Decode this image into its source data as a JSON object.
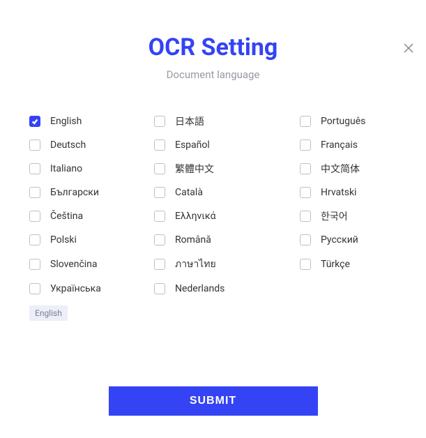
{
  "title": "OCR Setting",
  "subtitle": "Document language",
  "languages": [
    {
      "label": "English",
      "checked": true
    },
    {
      "label": "日本語",
      "checked": false
    },
    {
      "label": "Português",
      "checked": false
    },
    {
      "label": "Deutsch",
      "checked": false
    },
    {
      "label": "Español",
      "checked": false
    },
    {
      "label": "Français",
      "checked": false
    },
    {
      "label": "Italiano",
      "checked": false
    },
    {
      "label": "繁體中文",
      "checked": false
    },
    {
      "label": "中文简体",
      "checked": false
    },
    {
      "label": "Български",
      "checked": false
    },
    {
      "label": "Català",
      "checked": false
    },
    {
      "label": "Hrvatski",
      "checked": false
    },
    {
      "label": "Čeština",
      "checked": false
    },
    {
      "label": "Ελληνικά",
      "checked": false
    },
    {
      "label": "한국어",
      "checked": false
    },
    {
      "label": "Polski",
      "checked": false
    },
    {
      "label": "Română",
      "checked": false
    },
    {
      "label": "Русский",
      "checked": false
    },
    {
      "label": "Slovenčina",
      "checked": false
    },
    {
      "label": "ภาษาไทย",
      "checked": false
    },
    {
      "label": "Türkçe",
      "checked": false
    },
    {
      "label": "Українська",
      "checked": false
    },
    {
      "label": "Nederlands",
      "checked": false
    }
  ],
  "selected_tag": "English",
  "submit_label": "SUBMIT"
}
